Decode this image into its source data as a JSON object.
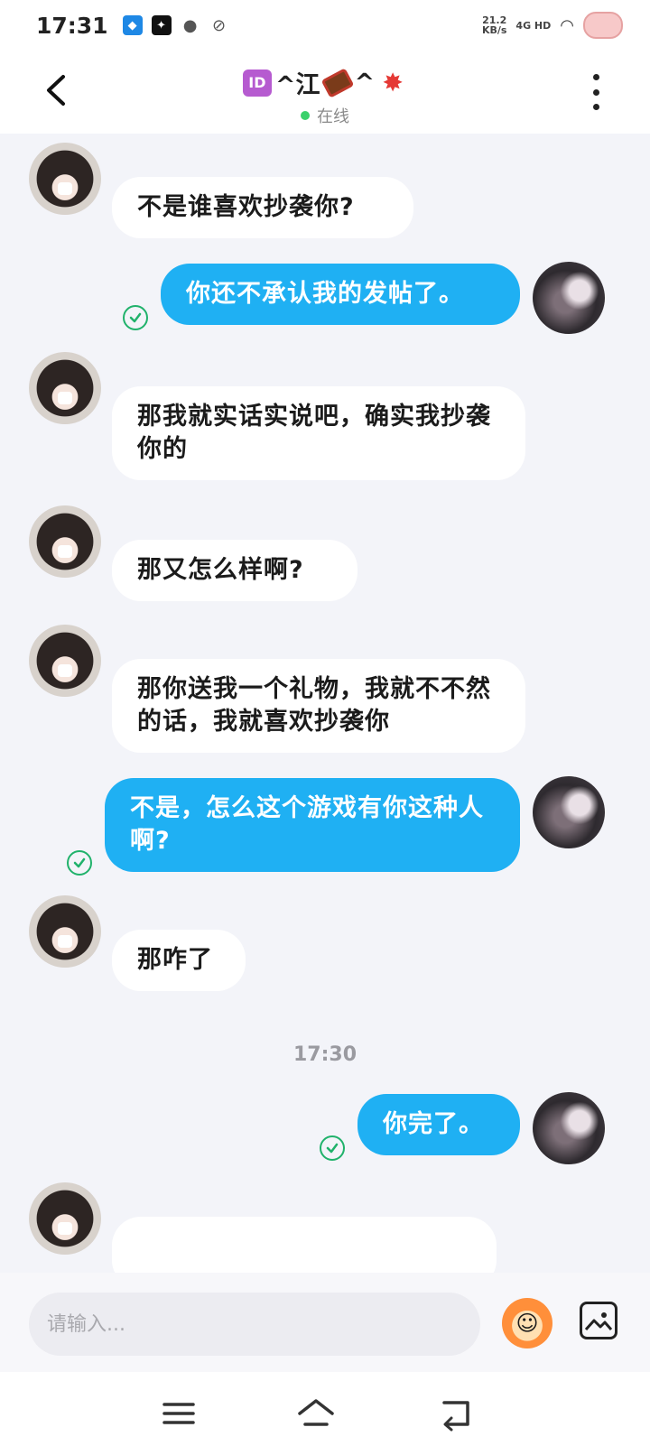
{
  "status_bar": {
    "time": "17:31",
    "speed_value": "21.2",
    "speed_unit": "KB/s",
    "network": "4G HD"
  },
  "header": {
    "title": "^江",
    "title_suffix": "^",
    "id_badge": "ID",
    "status": "在线",
    "back_icon": "chevron-left-icon",
    "more_icon": "vertical-dots-icon"
  },
  "messages": [
    {
      "from": "other",
      "text": "不是谁喜欢抄袭你?"
    },
    {
      "from": "self",
      "text": "你还不承认我的发帖了。"
    },
    {
      "from": "other",
      "text": "那我就实话实说吧，确实我抄袭你的"
    },
    {
      "from": "other",
      "text": "那又怎么样啊?"
    },
    {
      "from": "other",
      "text": "那你送我一个礼物，我就不不然的话，我就喜欢抄袭你"
    },
    {
      "from": "self",
      "text": "不是，怎么这个游戏有你这种人啊?"
    },
    {
      "from": "other",
      "text": "那咋了"
    },
    {
      "from": "self",
      "text": "你完了。"
    }
  ],
  "timestamp": "17:30",
  "input": {
    "placeholder": "请输入..."
  },
  "colors": {
    "outgoing_bubble": "#1fb0f3",
    "incoming_bubble": "#ffffff",
    "chat_background": "#f3f4f9",
    "online_dot": "#3ad16b",
    "read_check": "#20b26b"
  }
}
